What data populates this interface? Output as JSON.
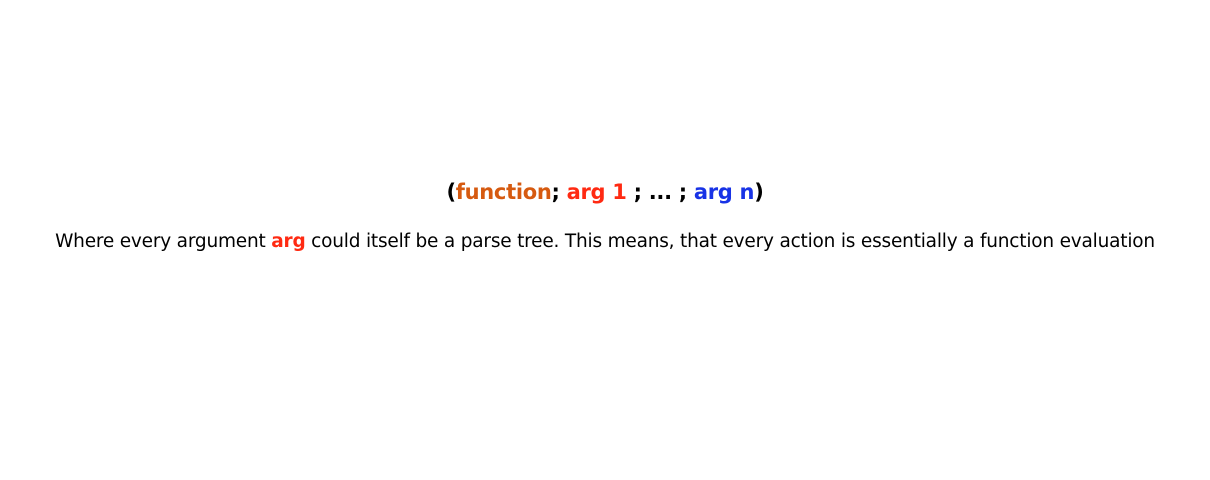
{
  "formula": {
    "open_paren": "(",
    "function_word": "function",
    "sep1": "; ",
    "arg1": "arg 1",
    "ellipsis": " ; ... ; ",
    "argn": "arg n",
    "close_paren": ")"
  },
  "caption": {
    "before": "Where every argument ",
    "highlight": "arg",
    "after": " could itself be a parse tree. This means, that every action is essentially a function evaluation"
  },
  "colors": {
    "function": "#d65a10",
    "arg": "#ff2a12",
    "arg_n": "#1833e6",
    "text": "#000000"
  }
}
